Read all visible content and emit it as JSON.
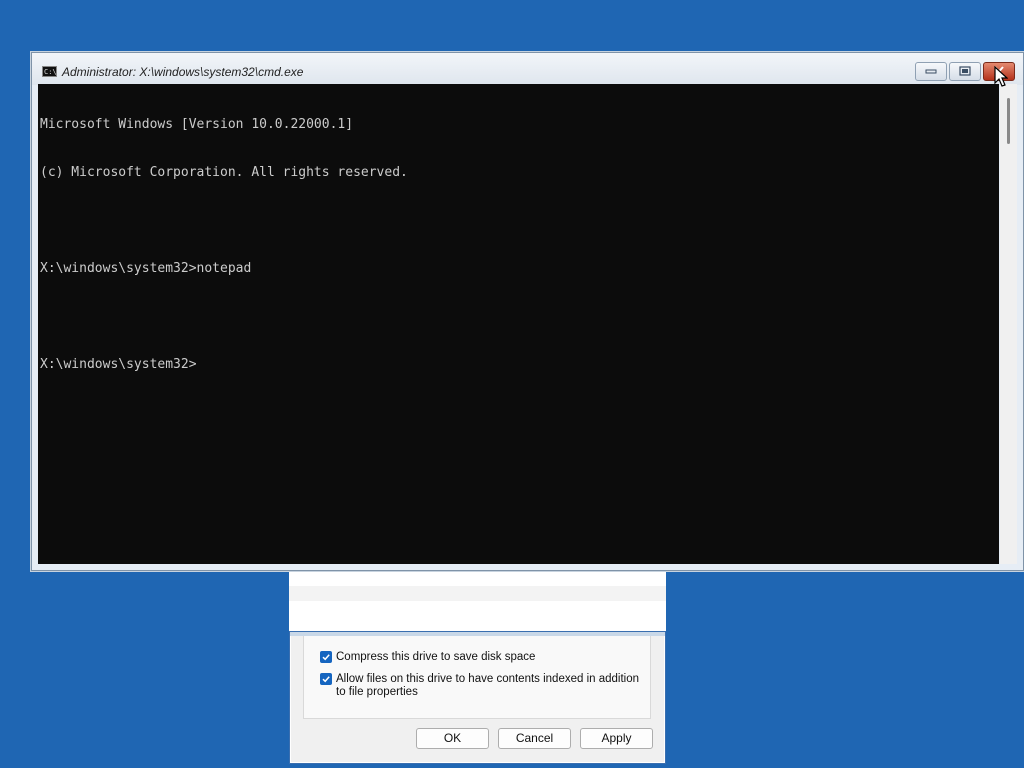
{
  "cmd_window": {
    "title": "Administrator: X:\\windows\\system32\\cmd.exe",
    "icon": "cmd-app-icon",
    "icon_label": "C:\\",
    "console_lines": [
      "Microsoft Windows [Version 10.0.22000.1]",
      "(c) Microsoft Corporation. All rights reserved.",
      "",
      "X:\\windows\\system32>notepad",
      "",
      "X:\\windows\\system32>"
    ],
    "buttons": {
      "minimize": "minimize-icon",
      "maximize": "maximize-icon",
      "close": "close-icon"
    }
  },
  "properties_dialog": {
    "options": [
      {
        "label": "Compress this drive to save disk space",
        "checked": true
      },
      {
        "label": "Allow files on this drive to have contents indexed in addition",
        "label2": "to file properties",
        "checked": true
      }
    ],
    "buttons": {
      "ok": "OK",
      "cancel": "Cancel",
      "apply": "Apply"
    }
  },
  "colors": {
    "desktop": "#1f66b3",
    "console_bg": "#0c0c0c",
    "console_text": "#cccccc",
    "checkbox": "#1565c0",
    "close_button": "#c4452a"
  }
}
